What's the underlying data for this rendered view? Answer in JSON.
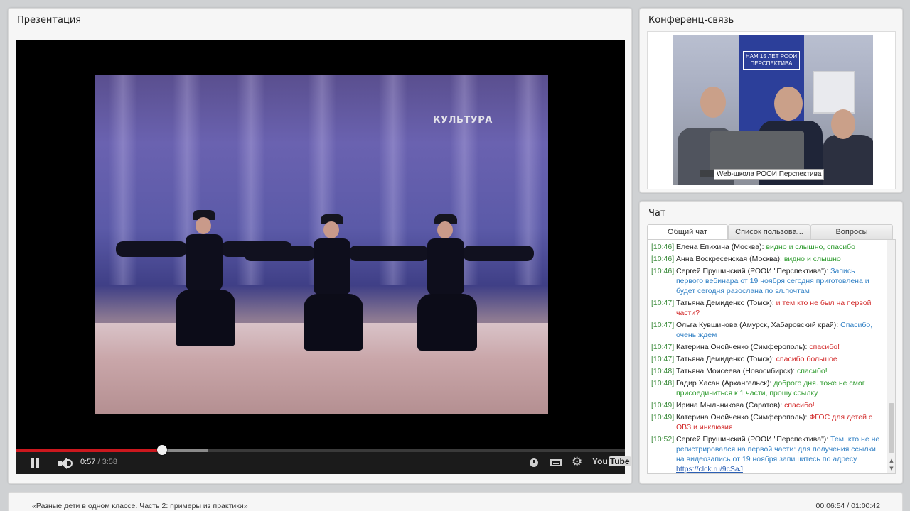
{
  "presentation": {
    "title": "Презентация",
    "video": {
      "channel_logo": "КУЛЬТУРА",
      "current_time": "0:57",
      "separator": " / ",
      "total_time": "3:58",
      "progress_fraction": 0.239,
      "buffered_fraction": 0.315,
      "youtube_logo_text": "You",
      "youtube_logo_tube": "Tube",
      "icons": [
        "pause-icon",
        "volume-icon",
        "watch-later-icon",
        "captions-icon",
        "settings-gear-icon",
        "youtube-logo"
      ]
    }
  },
  "conference": {
    "title": "Конференц-связь",
    "banner_text": "НАМ 15 ЛЕТ РООИ ПЕРСПЕКТИВА",
    "caption": "Web-школа РООИ Перспектива"
  },
  "chat": {
    "title": "Чат",
    "tabs": [
      {
        "label": "Общий чат",
        "active": true
      },
      {
        "label": "Список пользова...",
        "active": false
      },
      {
        "label": "Вопросы",
        "active": false
      }
    ],
    "messages": [
      {
        "time": "[10:46]",
        "author": "Елена Епихина (Москва):",
        "text": "видно и слышно, спасибо",
        "color": "green"
      },
      {
        "time": "[10:46]",
        "author": "Анна Воскресенская (Москва):",
        "text": "видно и слышно",
        "color": "green"
      },
      {
        "time": "[10:46]",
        "author": "Сергей Прушинский (РООИ \"Перспектива\"):",
        "text": "Запись первого вебинара от 19 ноября сегодня приготовлена и будет сегодня разослана по эл.почтам",
        "color": "blue"
      },
      {
        "time": "[10:47]",
        "author": "Татьяна Демиденко (Томск):",
        "text": "и тем кто не был на первой части?",
        "color": "red"
      },
      {
        "time": "[10:47]",
        "author": "Ольга Кувшинова (Амурск, Хабаровский край):",
        "text": "Спасибо, очень ждем",
        "color": "blue"
      },
      {
        "time": "[10:47]",
        "author": "Катерина Онойченко (Симферополь):",
        "text": "спасибо!",
        "color": "red"
      },
      {
        "time": "[10:47]",
        "author": "Татьяна Демиденко (Томск):",
        "text": "спасибо большое",
        "color": "red"
      },
      {
        "time": "[10:48]",
        "author": "Татьяна Моисеева (Новосибирск):",
        "text": "спасибо!",
        "color": "green"
      },
      {
        "time": "[10:48]",
        "author": "Гадир Хасан (Архангельск):",
        "text": "доброго дня. тоже не смог присоединиться к 1 части, прошу ссылку",
        "color": "green"
      },
      {
        "time": "[10:49]",
        "author": "Ирина Мыльникова (Саратов):",
        "text": "спасибо!",
        "color": "red"
      },
      {
        "time": "[10:49]",
        "author": "Катерина Онойченко (Симферополь):",
        "text": "ФГОС для детей с ОВЗ и инклюзия",
        "color": "red"
      },
      {
        "time": "[10:52]",
        "author": "Сергей Прушинский (РООИ \"Перспектива\"):",
        "text": "Тем, кто не не регистрировался на первой части: для получения ссылки на видеозапись от 19 ноября запишитесь по адресу",
        "color": "blue",
        "link": "https://clck.ru/9cSaJ"
      }
    ]
  },
  "footer": {
    "event_title": "«Разные дети в одном классе. Часть 2: примеры из практики»",
    "event_time": "00:06:54 / 01:00:42"
  }
}
